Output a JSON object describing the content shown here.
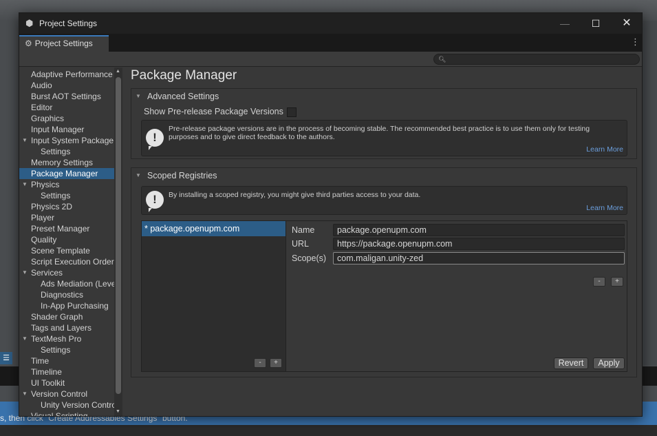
{
  "background": {
    "status_text": "s, then click \"Create Addressables Settings\" button."
  },
  "window": {
    "title": "Project Settings",
    "controls": {
      "minimize": "—",
      "maximize": "☐",
      "close": "✕"
    },
    "tab_label": "Project Settings",
    "search": {
      "placeholder": "",
      "icon": "search-icon"
    }
  },
  "sidebar": {
    "items": [
      {
        "label": "Adaptive Performance",
        "indent": 0
      },
      {
        "label": "Audio",
        "indent": 0
      },
      {
        "label": "Burst AOT Settings",
        "indent": 0
      },
      {
        "label": "Editor",
        "indent": 0
      },
      {
        "label": "Graphics",
        "indent": 0
      },
      {
        "label": "Input Manager",
        "indent": 0
      },
      {
        "label": "Input System Package",
        "indent": 0,
        "expanded": true
      },
      {
        "label": "Settings",
        "indent": 1
      },
      {
        "label": "Memory Settings",
        "indent": 0
      },
      {
        "label": "Package Manager",
        "indent": 0,
        "selected": true
      },
      {
        "label": "Physics",
        "indent": 0,
        "expanded": true
      },
      {
        "label": "Settings",
        "indent": 1
      },
      {
        "label": "Physics 2D",
        "indent": 0
      },
      {
        "label": "Player",
        "indent": 0
      },
      {
        "label": "Preset Manager",
        "indent": 0
      },
      {
        "label": "Quality",
        "indent": 0
      },
      {
        "label": "Scene Template",
        "indent": 0
      },
      {
        "label": "Script Execution Order",
        "indent": 0
      },
      {
        "label": "Services",
        "indent": 0,
        "expanded": true
      },
      {
        "label": "Ads Mediation (Levelplay)",
        "indent": 1
      },
      {
        "label": "Diagnostics",
        "indent": 1
      },
      {
        "label": "In-App Purchasing",
        "indent": 1
      },
      {
        "label": "Shader Graph",
        "indent": 0
      },
      {
        "label": "Tags and Layers",
        "indent": 0
      },
      {
        "label": "TextMesh Pro",
        "indent": 0,
        "expanded": true
      },
      {
        "label": "Settings",
        "indent": 1
      },
      {
        "label": "Time",
        "indent": 0
      },
      {
        "label": "Timeline",
        "indent": 0
      },
      {
        "label": "UI Toolkit",
        "indent": 0
      },
      {
        "label": "Version Control",
        "indent": 0,
        "expanded": true
      },
      {
        "label": "Unity Version Control",
        "indent": 1
      },
      {
        "label": "Visual Scripting",
        "indent": 0
      }
    ]
  },
  "main": {
    "title": "Package Manager",
    "advanced": {
      "header": "Advanced Settings",
      "prerelease_label": "Show Pre-release Package Versions",
      "prerelease_checked": false,
      "help_text": "Pre-release package versions are in the process of becoming stable. The recommended best practice is to use them only for testing purposes and to give direct feedback to the authors.",
      "learn_more": "Learn More"
    },
    "scoped": {
      "header": "Scoped Registries",
      "help_text": "By installing a scoped registry, you might give third parties access to your data.",
      "learn_more": "Learn More",
      "registries": [
        "* package.openupm.com"
      ],
      "list_minus": "-",
      "list_plus": "+",
      "name_label": "Name",
      "name_value": "package.openupm.com",
      "url_label": "URL",
      "url_value": "https://package.openupm.com",
      "scopes_label": "Scope(s)",
      "scope_value": "com.maligan.unity-zed",
      "scope_minus": "-",
      "scope_plus": "+",
      "revert": "Revert",
      "apply": "Apply"
    }
  }
}
